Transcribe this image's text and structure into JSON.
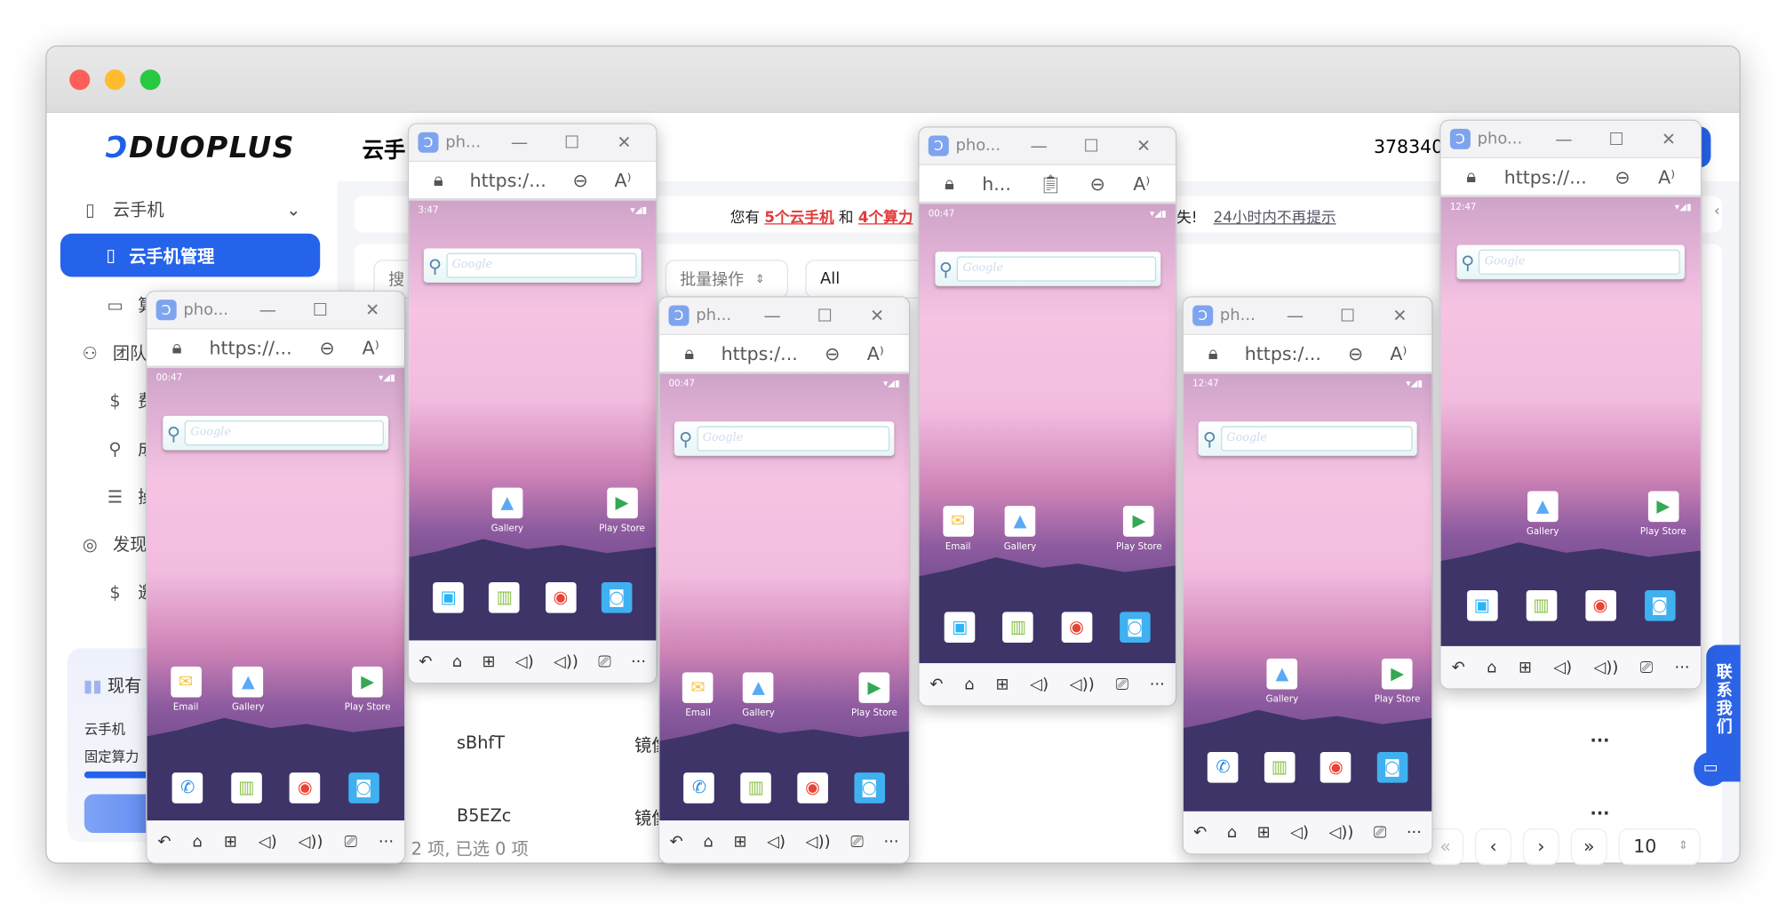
{
  "app": {
    "logo": "DUOPLUS",
    "sidebar": {
      "items": [
        {
          "label": "云手机",
          "icon": "phone-outline-icon"
        },
        {
          "label": "云手机管理",
          "icon": "phone-icon"
        },
        {
          "label": "算",
          "icon": "monitor-icon"
        },
        {
          "label": "团队",
          "icon": "users-icon"
        },
        {
          "label": "费",
          "icon": "dollar-circle-icon"
        },
        {
          "label": "成",
          "icon": "user-gear-icon"
        },
        {
          "label": "操",
          "icon": "document-icon"
        },
        {
          "label": "发现",
          "icon": "compass-icon"
        },
        {
          "label": "邀",
          "icon": "dollar-icon"
        }
      ],
      "card": {
        "title": "现有",
        "line1": "云手机",
        "line2": "固定算力"
      }
    },
    "header": {
      "title": "云手",
      "account": "378340"
    },
    "notice": {
      "prefix": "您有",
      "phones": "5个云手机",
      "and": "和",
      "compute": "4个算力",
      "suffix": "失!",
      "dismiss": "24小时内不再提示"
    },
    "filters": {
      "search": "搜",
      "batch": "批量操作",
      "status": "All"
    },
    "table": {
      "rows": [
        {
          "id": "sBhfT",
          "image": "镜像"
        },
        {
          "id": "B5EZc",
          "image": "镜像"
        }
      ],
      "more": "..."
    },
    "footer": {
      "summary": "2 项, 已选 0 项"
    },
    "pagination": {
      "first": "«",
      "prev": "‹",
      "next": "›",
      "last": "»",
      "page_size": "10"
    },
    "contact": "联系我们",
    "accent": "#2563eb"
  },
  "windows": [
    {
      "title": "pho...",
      "url": "https://...",
      "clipboard": false,
      "time": "00:47",
      "apps": [
        "Email",
        "Gallery",
        "Play Store"
      ]
    },
    {
      "title": "ph...",
      "url": "https:/...",
      "clipboard": false,
      "time": "3:47",
      "apps": [
        "Gallery",
        "Play Store"
      ]
    },
    {
      "title": "ph...",
      "url": "https:/...",
      "clipboard": false,
      "time": "00:47",
      "apps": [
        "Email",
        "Gallery",
        "Play Store"
      ]
    },
    {
      "title": "pho...",
      "url": "h...",
      "clipboard": true,
      "time": "00:47",
      "apps": [
        "Email",
        "Gallery",
        "Play Store"
      ]
    },
    {
      "title": "ph...",
      "url": "https:/...",
      "clipboard": false,
      "time": "12:47",
      "apps": [
        "Gallery",
        "Play Store"
      ]
    },
    {
      "title": "pho...",
      "url": "https://...",
      "clipboard": false,
      "time": "12:47",
      "apps": [
        "Gallery",
        "Play Store"
      ]
    }
  ],
  "search_widget": "Google",
  "dock_icons": [
    "phone-icon",
    "contacts-icon",
    "files-icon",
    "chrome-icon",
    "camera-icon"
  ],
  "nav_icons": [
    "back-icon",
    "home-icon",
    "apps-icon",
    "volume-down-icon",
    "volume-up-icon",
    "screen-icon",
    "more-icon"
  ]
}
